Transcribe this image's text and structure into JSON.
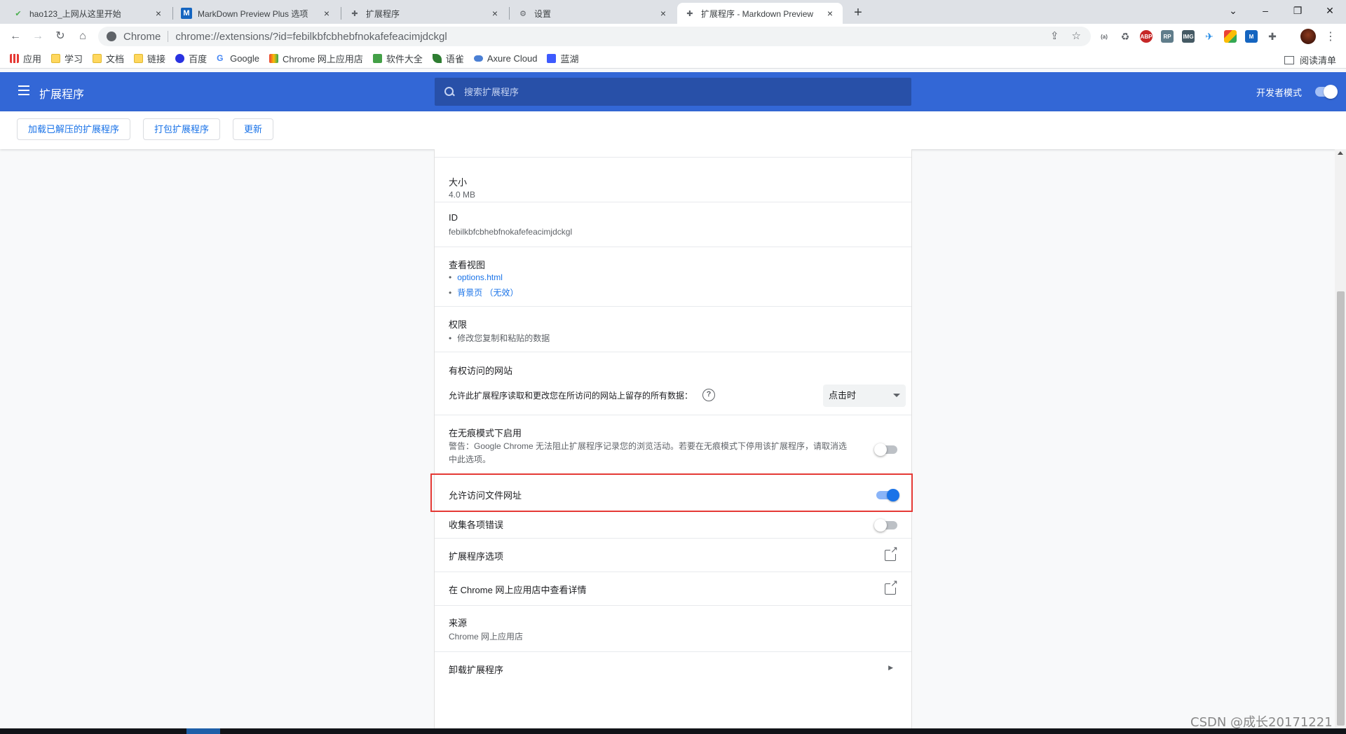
{
  "tabs": [
    {
      "title": "hao123_上网从这里开始",
      "favicon": "hao123-icon",
      "active": false
    },
    {
      "title": "MarkDown Preview Plus 选项",
      "favicon": "markdown-icon",
      "active": false
    },
    {
      "title": "扩展程序",
      "favicon": "puzzle-icon",
      "active": false
    },
    {
      "title": "设置",
      "favicon": "gear-icon",
      "active": false
    },
    {
      "title": "扩展程序 - Markdown Preview",
      "favicon": "puzzle-icon",
      "active": true
    }
  ],
  "omnibox": {
    "brand": "Chrome",
    "url": "chrome://extensions/?id=febilkbfcbhebfnokafefeacimjdckgl"
  },
  "bookmarks": [
    {
      "label": "应用",
      "icon": "apps-grid-icon"
    },
    {
      "label": "学习",
      "icon": "folder-icon"
    },
    {
      "label": "文档",
      "icon": "folder-icon"
    },
    {
      "label": "链接",
      "icon": "folder-icon"
    },
    {
      "label": "百度",
      "icon": "baidu-icon"
    },
    {
      "label": "Google",
      "icon": "google-icon"
    },
    {
      "label": "Chrome 网上应用店",
      "icon": "webstore-icon"
    },
    {
      "label": "软件大全",
      "icon": "download-icon"
    },
    {
      "label": "语雀",
      "icon": "yuque-icon"
    },
    {
      "label": "Axure Cloud",
      "icon": "cloud-icon"
    },
    {
      "label": "蓝湖",
      "icon": "lanhu-icon"
    }
  ],
  "reading_list": "阅读清单",
  "header": {
    "title": "扩展程序",
    "search_placeholder": "搜索扩展程序",
    "dev_mode_label": "开发者模式",
    "dev_mode_on": true
  },
  "dev_actions": {
    "load_unpacked": "加载已解压的扩展程序",
    "pack": "打包扩展程序",
    "update": "更新"
  },
  "details": {
    "size_label": "大小",
    "size_value": "4.0 MB",
    "id_label": "ID",
    "id_value": "febilkbfcbhebfnokafefeacimjdckgl",
    "views_label": "查看视图",
    "view_options": "options.html",
    "view_background": "背景页 （无效）",
    "permissions_label": "权限",
    "permission_item": "修改您复制和粘贴的数据",
    "site_access_label": "有权访问的网站",
    "site_access_desc": "允许此扩展程序读取和更改您在所访问的网站上留存的所有数据：",
    "site_access_value": "点击时",
    "incognito_label": "在无痕模式下启用",
    "incognito_warning": "警告：Google Chrome 无法阻止扩展程序记录您的浏览活动。若要在无痕模式下停用该扩展程序，请取消选中此选项。",
    "incognito_on": false,
    "file_urls_label": "允许访问文件网址",
    "file_urls_on": true,
    "collect_errors_label": "收集各项错误",
    "collect_errors_on": false,
    "ext_options_label": "扩展程序选项",
    "webstore_label": "在 Chrome 网上应用店中查看详情",
    "source_label": "来源",
    "source_value": "Chrome 网上应用店",
    "remove_label": "卸载扩展程序"
  },
  "watermark": "CSDN @成长20171221"
}
